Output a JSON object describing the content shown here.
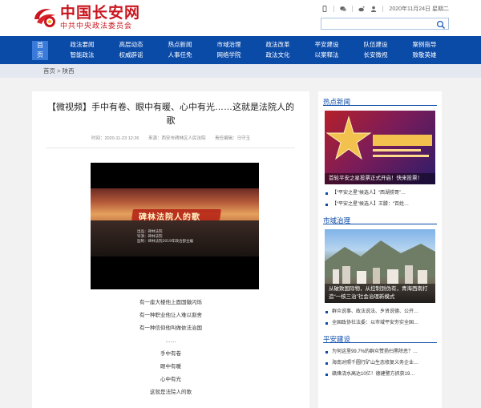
{
  "header": {
    "logo_main": "中国长安网",
    "logo_sub": "中共中央政法委员会",
    "date": "2020年11月24日 星期二",
    "search_placeholder": ""
  },
  "nav": {
    "home": [
      "首",
      "页"
    ],
    "items": [
      "政法要闻",
      "高层动态",
      "热点新闻",
      "市域治理",
      "政法改革",
      "平安建设",
      "队伍建设",
      "案例指导",
      "智能政法",
      "权威辟谣",
      "人事任免",
      "网络学院",
      "政法文化",
      "以案释法",
      "长安微视",
      "致敬英雄"
    ]
  },
  "breadcrumb": {
    "home": "首页",
    "sep": ">",
    "current": "陕西"
  },
  "article": {
    "title": "【微视频】手中有卷、眼中有暖、心中有光……这就是法院人的歌",
    "time": "时间：2020-11-23 12:26",
    "source": "来源：西安市碑林区人民法院",
    "editor": "责任编辑：马守玉",
    "video_banner": "碑林法院人的歌",
    "video_credits": [
      "出品：碑林法院",
      "导演：碑林法院",
      "监制：碑林法院2019年政治部主编"
    ],
    "lines": [
      "有一座大楼他上面国徽闪烁",
      "有一种职业他让人难以割舍",
      "有一种信仰他叫做依法治国",
      "……",
      "手中有卷",
      "眼中有暖",
      "心中有光",
      "这就是法院人的歌"
    ]
  },
  "sidebar": {
    "sections": [
      {
        "heading": "热点新闻",
        "caption": "首轮平安之星投票正式开启！快来投票！",
        "items": [
          "【“平安之星”候选人】“西湖捞哥”…",
          "【“平安之星”候选人】王滕：“百姓…"
        ]
      },
      {
        "heading": "市域治理",
        "caption": "从破致国际物，从控制到伪有，青海西南打造“一核三治”社会治理新模式",
        "items": [
          "群众说事、政法说法、乡贤说德、公开…",
          "全国政协社法委：以市域平安夯实全国…"
        ]
      },
      {
        "heading": "平安建设",
        "caption": "",
        "items": [
          "为何这里99.7%的群众赞扬扫黑除恶？…",
          "海南对照千圆行矿山生态修复义务企业…",
          "赣烽浇水高达10亿！德建警方抓获19…"
        ]
      }
    ]
  },
  "colors": {
    "brand_red": "#c9151e",
    "nav_blue": "#0b4ba8"
  }
}
